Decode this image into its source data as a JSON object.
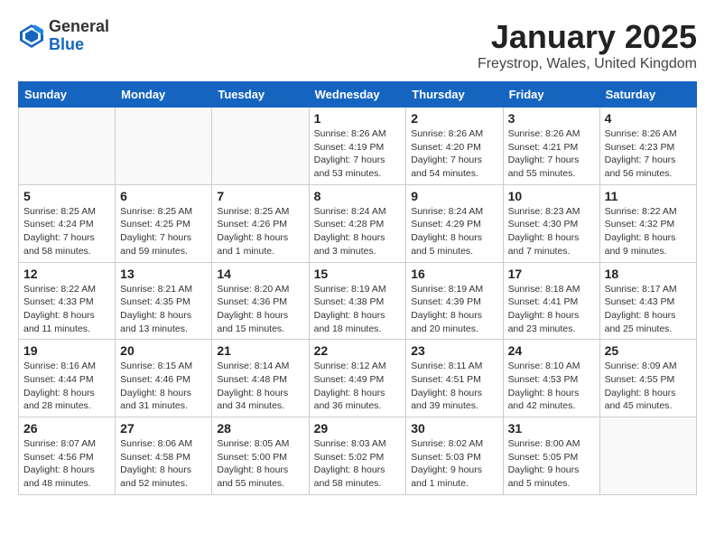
{
  "logo": {
    "general": "General",
    "blue": "Blue"
  },
  "title": "January 2025",
  "subtitle": "Freystrop, Wales, United Kingdom",
  "days_of_week": [
    "Sunday",
    "Monday",
    "Tuesday",
    "Wednesday",
    "Thursday",
    "Friday",
    "Saturday"
  ],
  "weeks": [
    [
      {
        "day": "",
        "info": ""
      },
      {
        "day": "",
        "info": ""
      },
      {
        "day": "",
        "info": ""
      },
      {
        "day": "1",
        "info": "Sunrise: 8:26 AM\nSunset: 4:19 PM\nDaylight: 7 hours and 53 minutes."
      },
      {
        "day": "2",
        "info": "Sunrise: 8:26 AM\nSunset: 4:20 PM\nDaylight: 7 hours and 54 minutes."
      },
      {
        "day": "3",
        "info": "Sunrise: 8:26 AM\nSunset: 4:21 PM\nDaylight: 7 hours and 55 minutes."
      },
      {
        "day": "4",
        "info": "Sunrise: 8:26 AM\nSunset: 4:23 PM\nDaylight: 7 hours and 56 minutes."
      }
    ],
    [
      {
        "day": "5",
        "info": "Sunrise: 8:25 AM\nSunset: 4:24 PM\nDaylight: 7 hours and 58 minutes."
      },
      {
        "day": "6",
        "info": "Sunrise: 8:25 AM\nSunset: 4:25 PM\nDaylight: 7 hours and 59 minutes."
      },
      {
        "day": "7",
        "info": "Sunrise: 8:25 AM\nSunset: 4:26 PM\nDaylight: 8 hours and 1 minute."
      },
      {
        "day": "8",
        "info": "Sunrise: 8:24 AM\nSunset: 4:28 PM\nDaylight: 8 hours and 3 minutes."
      },
      {
        "day": "9",
        "info": "Sunrise: 8:24 AM\nSunset: 4:29 PM\nDaylight: 8 hours and 5 minutes."
      },
      {
        "day": "10",
        "info": "Sunrise: 8:23 AM\nSunset: 4:30 PM\nDaylight: 8 hours and 7 minutes."
      },
      {
        "day": "11",
        "info": "Sunrise: 8:22 AM\nSunset: 4:32 PM\nDaylight: 8 hours and 9 minutes."
      }
    ],
    [
      {
        "day": "12",
        "info": "Sunrise: 8:22 AM\nSunset: 4:33 PM\nDaylight: 8 hours and 11 minutes."
      },
      {
        "day": "13",
        "info": "Sunrise: 8:21 AM\nSunset: 4:35 PM\nDaylight: 8 hours and 13 minutes."
      },
      {
        "day": "14",
        "info": "Sunrise: 8:20 AM\nSunset: 4:36 PM\nDaylight: 8 hours and 15 minutes."
      },
      {
        "day": "15",
        "info": "Sunrise: 8:19 AM\nSunset: 4:38 PM\nDaylight: 8 hours and 18 minutes."
      },
      {
        "day": "16",
        "info": "Sunrise: 8:19 AM\nSunset: 4:39 PM\nDaylight: 8 hours and 20 minutes."
      },
      {
        "day": "17",
        "info": "Sunrise: 8:18 AM\nSunset: 4:41 PM\nDaylight: 8 hours and 23 minutes."
      },
      {
        "day": "18",
        "info": "Sunrise: 8:17 AM\nSunset: 4:43 PM\nDaylight: 8 hours and 25 minutes."
      }
    ],
    [
      {
        "day": "19",
        "info": "Sunrise: 8:16 AM\nSunset: 4:44 PM\nDaylight: 8 hours and 28 minutes."
      },
      {
        "day": "20",
        "info": "Sunrise: 8:15 AM\nSunset: 4:46 PM\nDaylight: 8 hours and 31 minutes."
      },
      {
        "day": "21",
        "info": "Sunrise: 8:14 AM\nSunset: 4:48 PM\nDaylight: 8 hours and 34 minutes."
      },
      {
        "day": "22",
        "info": "Sunrise: 8:12 AM\nSunset: 4:49 PM\nDaylight: 8 hours and 36 minutes."
      },
      {
        "day": "23",
        "info": "Sunrise: 8:11 AM\nSunset: 4:51 PM\nDaylight: 8 hours and 39 minutes."
      },
      {
        "day": "24",
        "info": "Sunrise: 8:10 AM\nSunset: 4:53 PM\nDaylight: 8 hours and 42 minutes."
      },
      {
        "day": "25",
        "info": "Sunrise: 8:09 AM\nSunset: 4:55 PM\nDaylight: 8 hours and 45 minutes."
      }
    ],
    [
      {
        "day": "26",
        "info": "Sunrise: 8:07 AM\nSunset: 4:56 PM\nDaylight: 8 hours and 48 minutes."
      },
      {
        "day": "27",
        "info": "Sunrise: 8:06 AM\nSunset: 4:58 PM\nDaylight: 8 hours and 52 minutes."
      },
      {
        "day": "28",
        "info": "Sunrise: 8:05 AM\nSunset: 5:00 PM\nDaylight: 8 hours and 55 minutes."
      },
      {
        "day": "29",
        "info": "Sunrise: 8:03 AM\nSunset: 5:02 PM\nDaylight: 8 hours and 58 minutes."
      },
      {
        "day": "30",
        "info": "Sunrise: 8:02 AM\nSunset: 5:03 PM\nDaylight: 9 hours and 1 minute."
      },
      {
        "day": "31",
        "info": "Sunrise: 8:00 AM\nSunset: 5:05 PM\nDaylight: 9 hours and 5 minutes."
      },
      {
        "day": "",
        "info": ""
      }
    ]
  ]
}
